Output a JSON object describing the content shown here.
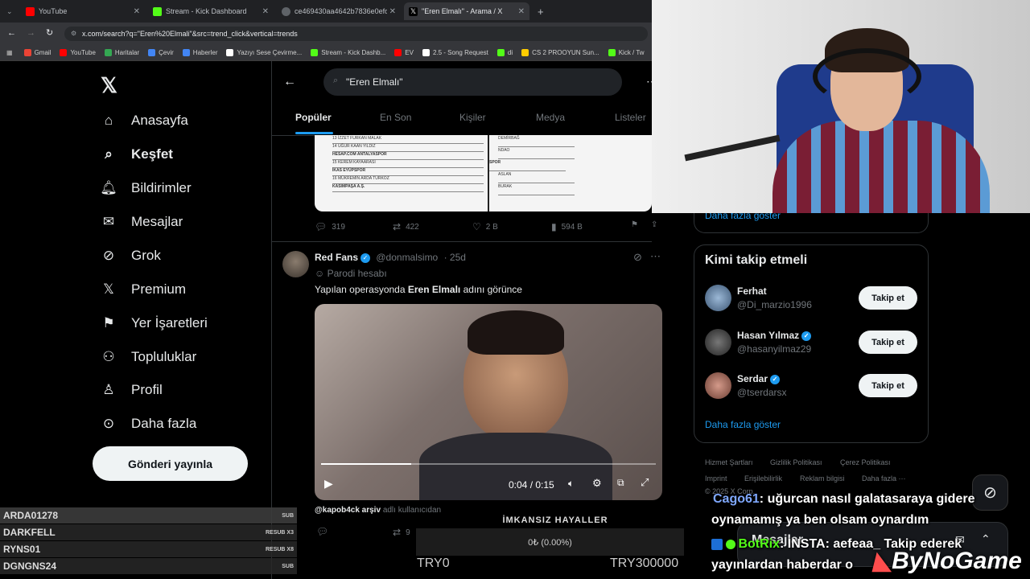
{
  "browser": {
    "tabs": [
      {
        "title": "YouTube",
        "color": "#ff0000"
      },
      {
        "title": "Stream - Kick Dashboard",
        "color": "#53fc18"
      },
      {
        "title": "ce469430aa4642b7836e0efdd0",
        "color": "#9aa0a6"
      },
      {
        "title": "\"Eren Elmalı\" - Arama / X",
        "color": "#ffffff"
      }
    ],
    "url": "x.com/search?q=\"Eren%20Elmali\"&src=trend_click&vertical=trends",
    "bookmarks": [
      {
        "label": "Gmail",
        "color": "#ea4335"
      },
      {
        "label": "YouTube",
        "color": "#ff0000"
      },
      {
        "label": "Haritalar",
        "color": "#34a853"
      },
      {
        "label": "Çevir",
        "color": "#4285f4"
      },
      {
        "label": "Haberler",
        "color": "#4285f4"
      },
      {
        "label": "Yazıyı Sese Çevirme...",
        "color": "#ffffff"
      },
      {
        "label": "Stream - Kick Dashb...",
        "color": "#53fc18"
      },
      {
        "label": "EV",
        "color": "#ff0000"
      },
      {
        "label": "2.5 - Song Request",
        "color": "#ffffff"
      },
      {
        "label": "di",
        "color": "#53fc18"
      },
      {
        "label": "CS 2 PROOYUN Sun...",
        "color": "#ffcc00"
      },
      {
        "label": "Kick / Tw",
        "color": "#53fc18"
      }
    ]
  },
  "sidebar": {
    "items": [
      {
        "label": "Anasayfa",
        "icon": "home-icon"
      },
      {
        "label": "Keşfet",
        "icon": "search-icon"
      },
      {
        "label": "Bildirimler",
        "icon": "bell-icon"
      },
      {
        "label": "Mesajlar",
        "icon": "mail-icon"
      },
      {
        "label": "Grok",
        "icon": "grok-icon"
      },
      {
        "label": "Premium",
        "icon": "x-icon"
      },
      {
        "label": "Yer İşaretleri",
        "icon": "bookmark-icon"
      },
      {
        "label": "Topluluklar",
        "icon": "communities-icon"
      },
      {
        "label": "Profil",
        "icon": "profile-icon"
      },
      {
        "label": "Daha fazla",
        "icon": "more-icon"
      }
    ],
    "post_button": "Gönderi yayınla"
  },
  "search": {
    "query": "\"Eren Elmalı\"",
    "tabs": [
      "Popüler",
      "En Son",
      "Kişiler",
      "Medya",
      "Listeler"
    ]
  },
  "tweet1": {
    "doc_rows": [
      "13   İZZET FURKAN        MALAK",
      "14   UĞUR KAAN           YILDIZ",
      "HESAP.COM ANTALYASPOR",
      "15   KEREM               KAYAARASI",
      "İKAS EYÜPSPOR",
      "16   MÜKREMİN ARDA       TURKOZ",
      "KASIMPAŞA A.Ş."
    ],
    "doc_right": [
      "DEMİRBAĞ",
      "NDAO",
      "SPOR",
      "ASLAN",
      "BURAK"
    ],
    "replies": "319",
    "reposts": "422",
    "likes": "2 B",
    "views": "594 B"
  },
  "tweet2": {
    "name": "Red Fans",
    "handle": "@donmalsimo",
    "time": "· 25d",
    "parody": "Parodi hesabı",
    "text_before": "Yapılan operasyonda ",
    "text_bold": "Eren Elmalı",
    "text_after": " adını görünce",
    "video_time": "0:04 / 0:15",
    "progress": 0.27,
    "quoted_user": "@kapob4ck arşiv",
    "quoted_suffix": "adlı kullanıcıdan",
    "reposts": "9"
  },
  "right": {
    "show_more_top": "Daha fazla göster",
    "who_to_follow_title": "Kimi takip etmeli",
    "follow": [
      {
        "name": "Ferhat",
        "handle": "@Di_marzio1996",
        "verified": false,
        "button": "Takip et"
      },
      {
        "name": "Hasan Yılmaz",
        "handle": "@hasanyilmaz29",
        "verified": true,
        "button": "Takip et"
      },
      {
        "name": "Serdar",
        "handle": "@tserdarsx",
        "verified": true,
        "button": "Takip et"
      }
    ],
    "show_more": "Daha fazla göster",
    "footer": [
      "Hizmet Şartları",
      "Gizlilik Politikası",
      "Çerez Politikası",
      "Imprint",
      "Erişilebilirlik",
      "Reklam bilgisi",
      "Daha fazla ···",
      "© 2025 X Corp."
    ],
    "messages": "Mesajlar"
  },
  "overlay": {
    "subs": [
      {
        "name": "ARDA01278",
        "tag": "SUB"
      },
      {
        "name": "DARKFELL",
        "tag": "RESUB X3"
      },
      {
        "name": "RYNS01",
        "tag": "RESUB X8"
      },
      {
        "name": "DGNGNS24",
        "tag": "SUB"
      }
    ],
    "goal_banner": "İMKANSIZ HAYALLER",
    "goal_value": "0₺ (0.00%)",
    "goal_min": "TRY0",
    "goal_max": "TRY300000",
    "chat": [
      {
        "user": "Cago61",
        "text": ": uğurcan nasıl galatasaraya gidere"
      },
      {
        "user": "",
        "text": "oynamamış ya ben olsam oynardım"
      },
      {
        "user": "BotRix",
        "text": ": INSTA: aefeaa_ Takip ederek"
      },
      {
        "user": "",
        "text": "yayınlardan haberdar o"
      }
    ],
    "brand": "ByNoGame"
  }
}
